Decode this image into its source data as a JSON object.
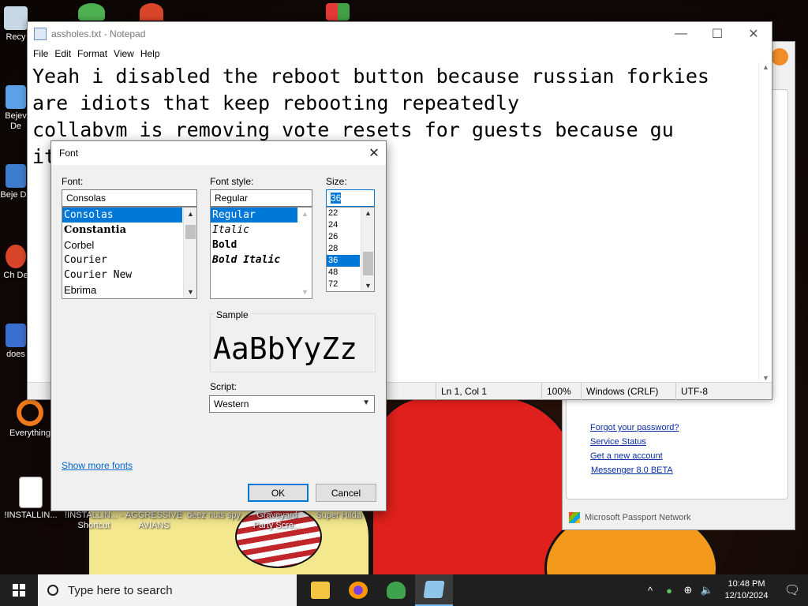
{
  "desktop": {
    "icons": [
      {
        "label": "Recy",
        "color": "#c8d7e6"
      },
      {
        "label": "Bejev De",
        "color": "#5ba0e8"
      },
      {
        "label": "Beje De",
        "color": "#3d7ccd"
      },
      {
        "label": "Ch De",
        "color": "#d9452b"
      },
      {
        "label": "does",
        "color": "#3b6fcf"
      },
      {
        "label": "Everything",
        "color": "#f07a1a"
      },
      {
        "label": "!INSTALLIN...",
        "color": "#ffffff"
      },
      {
        "label": "!INSTALLIN... - Shortcut",
        "color": "#dddddd"
      },
      {
        "label": "AGGRESSIVE AVIANS",
        "color": "#c04040"
      },
      {
        "label": "deez nuts spy",
        "color": "#6080c0"
      },
      {
        "label": "Graveyard Party Scre...",
        "color": "#708050"
      },
      {
        "label": "Super Hilda",
        "color": "#c0a040"
      }
    ]
  },
  "messenger": {
    "links": [
      "Forgot your password?",
      "Service Status",
      "Get a new account",
      "Messenger 8.0 BETA"
    ],
    "footer": "Microsoft Passport Network"
  },
  "notepad": {
    "title": "assholes.txt - Notepad",
    "menu": [
      "File",
      "Edit",
      "Format",
      "View",
      "Help"
    ],
    "controls": {
      "minimize": "—",
      "maximize": "☐",
      "close": "✕"
    },
    "content": "Yeah i disabled the reboot button because russian forkies are idiots that keep rebooting repeatedly\ncollabvm is removing vote resets for guests because gu                       it",
    "status": {
      "position": "Ln 1, Col 1",
      "zoom": "100%",
      "line_ending": "Windows (CRLF)",
      "encoding": "UTF-8"
    }
  },
  "font_dialog": {
    "title": "Font",
    "close": "✕",
    "font_label": "Font:",
    "font_value": "Consolas",
    "fonts": [
      "Consolas",
      "Constantia",
      "Corbel",
      "Courier",
      "Courier New",
      "Ebrima"
    ],
    "selected_font": "Consolas",
    "style_label": "Font style:",
    "style_value": "Regular",
    "styles": [
      "Regular",
      "Italic",
      "Bold",
      "Bold Italic"
    ],
    "selected_style": "Regular",
    "size_label": "Size:",
    "size_value": "36",
    "sizes": [
      "22",
      "24",
      "26",
      "28",
      "36",
      "48",
      "72"
    ],
    "selected_size": "36",
    "sample_label": "Sample",
    "sample_text": "AaBbYyZz",
    "script_label": "Script:",
    "script_value": "Western",
    "show_more": "Show more fonts",
    "ok": "OK",
    "cancel": "Cancel",
    "accent": "#0078d7"
  },
  "taskbar": {
    "search_placeholder": "Type here to search",
    "apps": [
      "file-explorer",
      "firefox",
      "msn-messenger",
      "notepad"
    ],
    "time": "10:48 PM",
    "date": "12/10/2024",
    "tray": {
      "chevron": "^",
      "notification": "🗨"
    }
  }
}
